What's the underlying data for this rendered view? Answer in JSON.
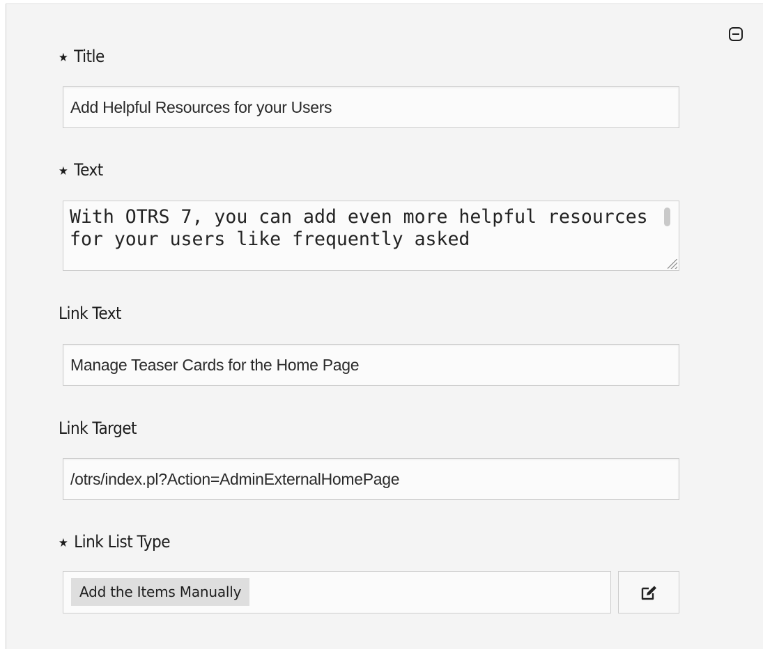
{
  "header": {
    "collapse_icon": "collapse-minus-icon"
  },
  "fields": {
    "title": {
      "required_mark": "★",
      "label": "Title",
      "value": "Add Helpful Resources for your Users"
    },
    "text": {
      "required_mark": "★",
      "label": "Text",
      "value": "With OTRS 7, you can add even more helpful resources for your users like frequently asked"
    },
    "link_text": {
      "label": "Link Text",
      "value": "Manage Teaser Cards for the Home Page"
    },
    "link_target": {
      "label": "Link Target",
      "value": "/otrs/index.pl?Action=AdminExternalHomePage"
    },
    "link_list_type": {
      "required_mark": "★",
      "label": "Link List Type",
      "selected": "Add the Items Manually",
      "edit_icon": "edit-icon"
    }
  }
}
